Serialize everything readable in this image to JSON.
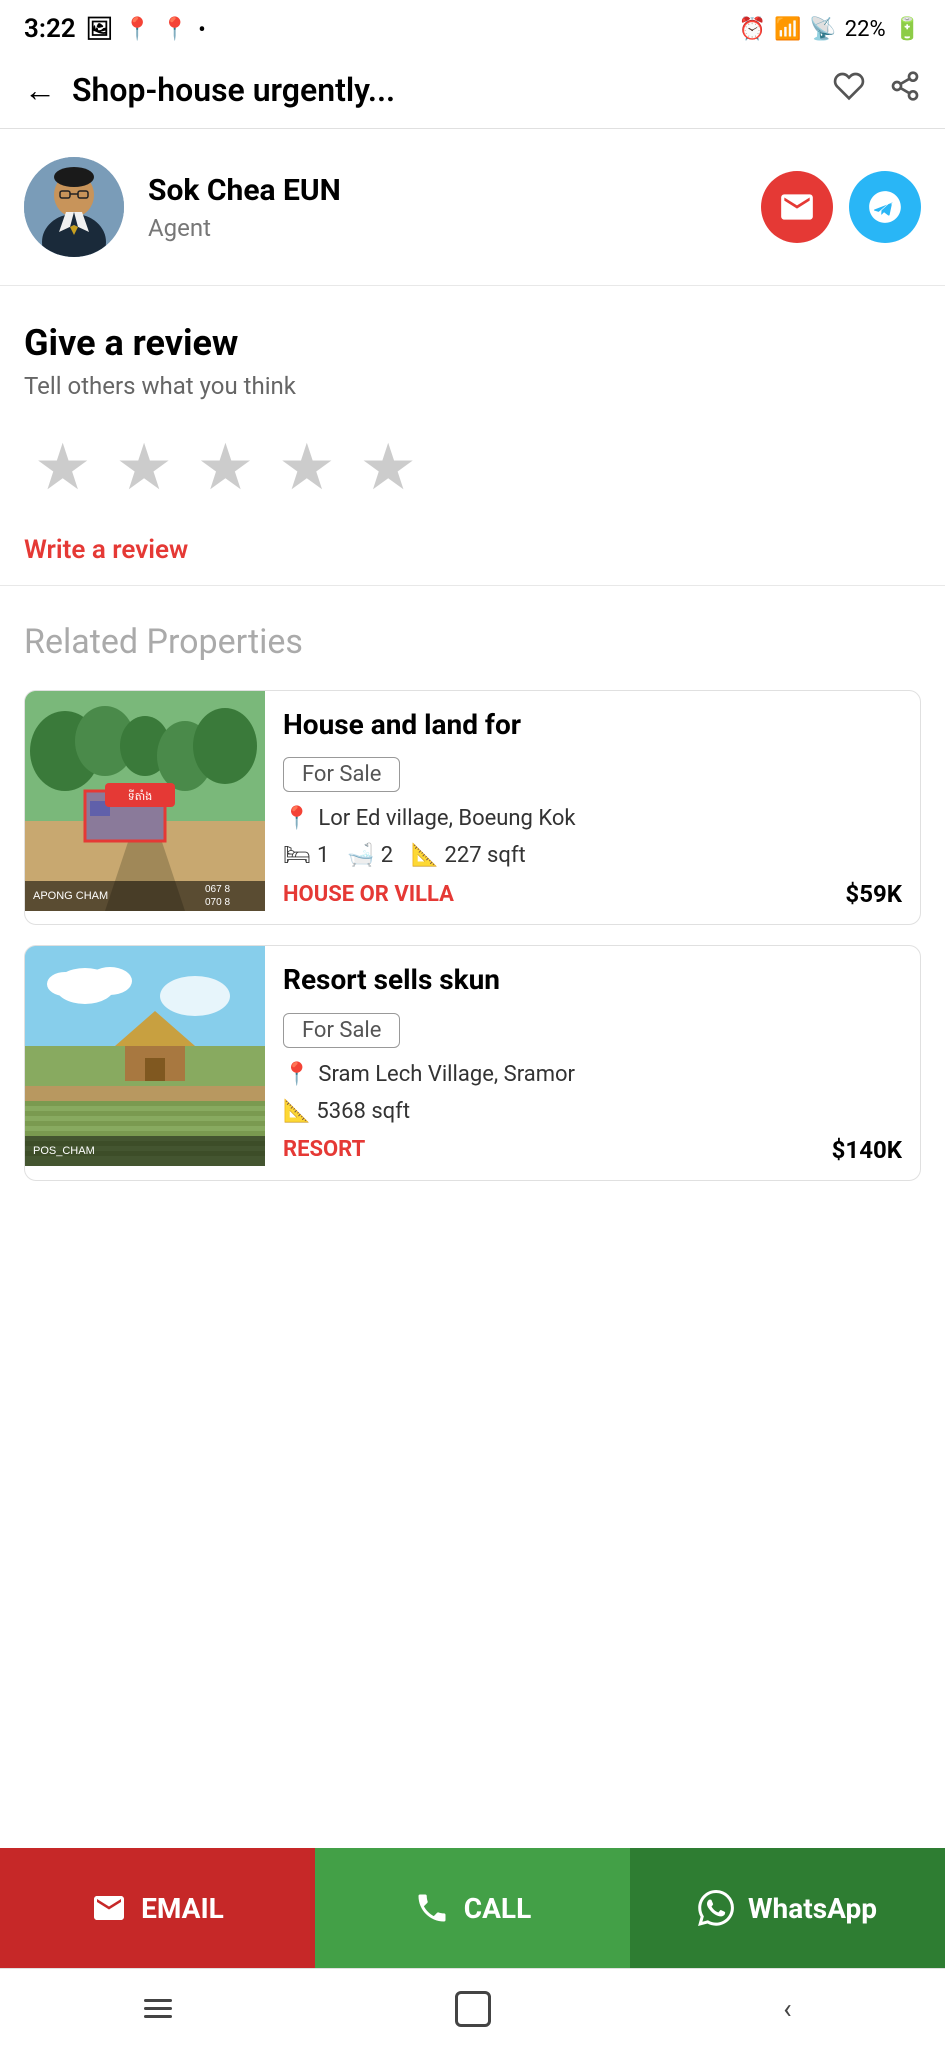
{
  "statusBar": {
    "time": "3:22",
    "battery": "22%"
  },
  "header": {
    "title": "Shop-house urgently...",
    "backLabel": "←",
    "favoriteLabel": "♡",
    "shareLabel": "⎙"
  },
  "agent": {
    "name": "Sok Chea EUN",
    "role": "Agent",
    "emailBtnLabel": "email",
    "telegramBtnLabel": "telegram"
  },
  "review": {
    "title": "Give a review",
    "subtitle": "Tell others what you think",
    "writeLinkLabel": "Write a review",
    "stars": [
      "★",
      "★",
      "★",
      "★",
      "★"
    ]
  },
  "relatedProperties": {
    "sectionTitle": "Related Properties",
    "properties": [
      {
        "title": "House and land for",
        "badge": "For Sale",
        "location": "Lor Ed village, Boeung Kok",
        "beds": "1",
        "baths": "2",
        "area": "227 sqft",
        "type": "HOUSE OR VILLA",
        "price": "$59K",
        "imgLabel": "ទីតាំង"
      },
      {
        "title": "Resort sells skun",
        "badge": "For Sale",
        "location": "Sram Lech Village, Sramor",
        "beds": "",
        "baths": "",
        "area": "5368 sqft",
        "type": "RESORT",
        "price": "$140K",
        "imgLabel": ""
      }
    ]
  },
  "bottomBar": {
    "emailLabel": "EMAIL",
    "callLabel": "CALL",
    "whatsappLabel": "WhatsApp"
  },
  "androidNav": {
    "recent": "|||",
    "home": "□",
    "back": "<"
  }
}
